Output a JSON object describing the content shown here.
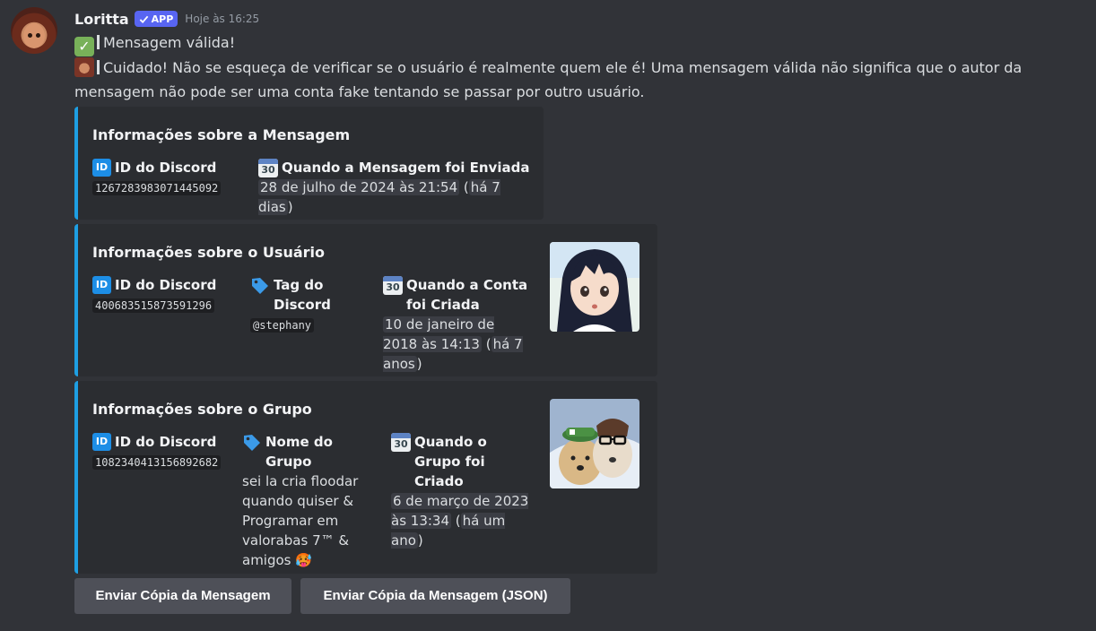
{
  "message": {
    "username": "Loritta",
    "badge": "APP",
    "timestamp": "Hoje às 16:25",
    "line1": "Mensagem válida!",
    "line2": "Cuidado! Não se esqueça de verificar se o usuário é realmente quem ele é! Uma mensagem válida não significa que o autor da",
    "line3": "mensagem não pode ser uma conta fake tentando se passar por outro usuário."
  },
  "embeds": [
    {
      "title": "Informações sobre a Mensagem",
      "fields": [
        {
          "icon": "id-icon",
          "name": "ID do Discord",
          "value": "1267283983071445092"
        },
        {
          "icon": "calendar-icon",
          "name": "Quando a Mensagem foi Enviada",
          "value_date": "28 de julho de 2024 às 21:54",
          "value_rel": "há 7 dias"
        }
      ]
    },
    {
      "title": "Informações sobre o Usuário",
      "fields": [
        {
          "icon": "id-icon",
          "name": "ID do Discord",
          "value": "400683515873591296"
        },
        {
          "icon": "tag-icon",
          "name": "Tag do Discord",
          "value": "@stephany"
        },
        {
          "icon": "calendar-icon",
          "name": "Quando a Conta foi Criada",
          "value_date": "10 de janeiro de 2018 às 14:13",
          "value_rel": "há 7 anos"
        }
      ],
      "thumbnail": "anime-girl-avatar"
    },
    {
      "title": "Informações sobre o Grupo",
      "fields": [
        {
          "icon": "id-icon",
          "name": "ID do Discord",
          "value": "1082340413156892682"
        },
        {
          "icon": "tag-icon",
          "name": "Nome do Grupo",
          "value": "sei la cria floodar quando quiser & Programar em valorabas 7™ & amigos 🥵"
        },
        {
          "icon": "calendar-icon",
          "name": "Quando o Grupo foi Criado",
          "value_date": "6 de março de 2023 às 13:34",
          "value_rel": "há um ano"
        }
      ],
      "thumbnail": "dogs-group-icon"
    }
  ],
  "buttons": {
    "send_copy": "Enviar Cópia da Mensagem",
    "send_copy_json": "Enviar Cópia da Mensagem (JSON)"
  },
  "calendar_icon_label": "30",
  "id_icon_label": "ID",
  "colors": {
    "background": "#313338",
    "embed": "#2b2d31",
    "accent": "#1e9fe3",
    "badge": "#5865f2"
  }
}
